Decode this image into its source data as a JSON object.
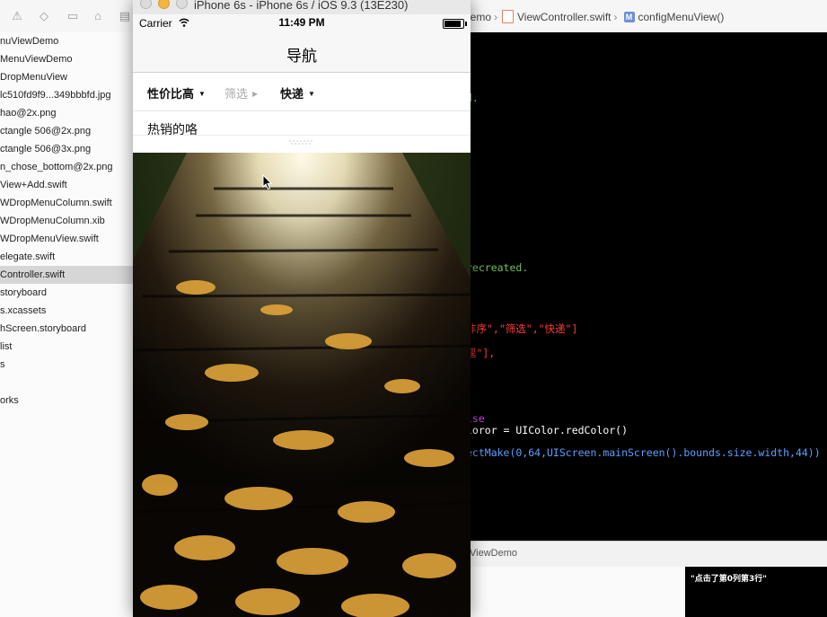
{
  "xcode": {
    "jumpbar": {
      "project": "Demo",
      "file": "ViewController.swift",
      "method": "configMenuView()"
    },
    "navigator_items": [
      {
        "label": "nuViewDemo",
        "selected": false
      },
      {
        "label": "MenuViewDemo",
        "selected": false
      },
      {
        "label": "DropMenuView",
        "selected": false
      },
      {
        "label": "lc510fd9f9...349bbbfd.jpg",
        "selected": false
      },
      {
        "label": "hao@2x.png",
        "selected": false
      },
      {
        "label": "ctangle 506@2x.png",
        "selected": false
      },
      {
        "label": "ctangle 506@3x.png",
        "selected": false
      },
      {
        "label": "n_chose_bottom@2x.png",
        "selected": false
      },
      {
        "label": "View+Add.swift",
        "selected": false
      },
      {
        "label": "WDropMenuColumn.swift",
        "selected": false
      },
      {
        "label": "WDropMenuColumn.xib",
        "selected": false
      },
      {
        "label": "WDropMenuView.swift",
        "selected": false
      },
      {
        "label": "elegate.swift",
        "selected": false
      },
      {
        "label": "Controller.swift",
        "selected": true
      },
      {
        "label": "storyboard",
        "selected": false
      },
      {
        "label": "s.xcassets",
        "selected": false
      },
      {
        "label": "hScreen.storyboard",
        "selected": false
      },
      {
        "label": "list",
        "selected": false
      },
      {
        "label": "s",
        "selected": false
      },
      {
        "label": "",
        "selected": false
      },
      {
        "label": "orks",
        "selected": false
      }
    ],
    "code_lines": [
      {
        "text": "d.",
        "color": "#6fc15b"
      },
      {
        "text": "recreated.",
        "color": "#6fc15b"
      },
      {
        "text": "非序\",\"筛选\",\"快递\"]",
        "color": "#ff3b3b"
      },
      {
        "text": "逕\"],",
        "color": "#ff3b3b"
      },
      {
        "text": "lse",
        "color": "#c34fd1"
      },
      {
        "text": "loror = UIColor.redColor()",
        "color": "#ffffff"
      },
      {
        "text": "ectMake(0,64,UIScreen.mainScreen().bounds.size.width,44))",
        "color": "#5aa0ff"
      }
    ],
    "debug_title": "ViewDemo",
    "console_output": "\"点击了第0列第3行\""
  },
  "simulator": {
    "window_title": "iPhone 6s - iPhone 6s / iOS 9.3 (13E230)",
    "status": {
      "carrier": "Carrier",
      "time": "11:49 PM"
    },
    "nav_title": "导航",
    "menu_columns": [
      {
        "label": "性价比高",
        "arrow": "▼",
        "color": "#111111",
        "bold": true
      },
      {
        "label": "筛选",
        "arrow": "▶",
        "color": "#a9a9a9",
        "bold": false
      },
      {
        "label": "快递",
        "arrow": "▼",
        "color": "#111111",
        "bold": true
      }
    ],
    "selected_row": "热销的咯"
  },
  "colors": {
    "selected_nav": "#d6d6d6",
    "accent_light": "#f3b540"
  }
}
